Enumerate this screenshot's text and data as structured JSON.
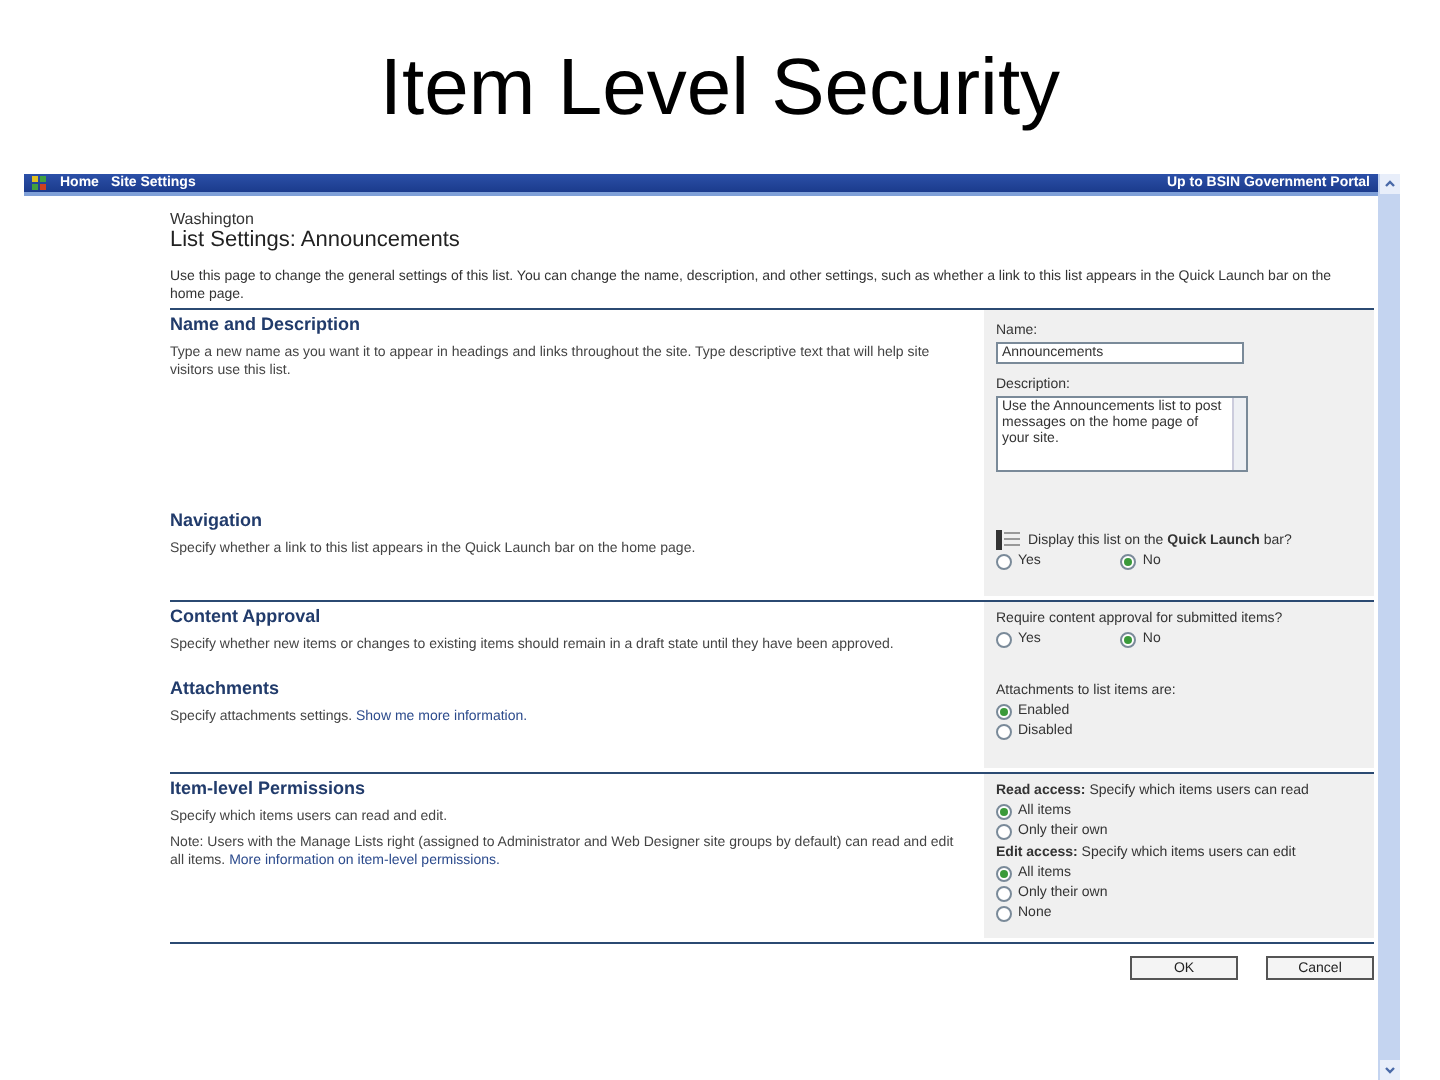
{
  "slide_title": "Item Level Security",
  "nav": {
    "links": [
      "Home",
      "Site Settings"
    ],
    "portal_link": "Up to BSIN Government Portal"
  },
  "site_name": "Washington",
  "page_title": "List Settings: Announcements",
  "intro": "Use this page to change the general settings of this list. You can change the name, description, and other settings, such as whether a link to this list appears in the Quick Launch bar on the home page.",
  "sections": [
    {
      "heading": "Name and Description",
      "divider_above": true,
      "descriptions": [
        {
          "text": "Type a new name as you want it to appear in headings and links throughout the site. Type descriptive text that will help site visitors use this list."
        }
      ],
      "fields": [
        {
          "kind": "text",
          "label": "Name:",
          "value": "Announcements"
        },
        {
          "kind": "textarea",
          "label": "Description:",
          "value": "Use the Announcements list to post messages on the home page of your site."
        }
      ]
    },
    {
      "heading": "Navigation",
      "divider_above": false,
      "descriptions": [
        {
          "text": "Specify whether a link to this list appears in the Quick Launch bar on the home page."
        }
      ],
      "fields": [
        {
          "kind": "radio-row",
          "label": "Display this list on the **Quick Launch** bar?",
          "options": [
            {
              "label": "Yes",
              "selected": false
            },
            {
              "label": "No",
              "selected": true
            }
          ]
        }
      ]
    },
    {
      "heading": "Content Approval",
      "divider_above": true,
      "descriptions": [
        {
          "text": "Specify whether new items or changes to existing items should remain in a draft state until they have been approved."
        }
      ],
      "fields": [
        {
          "kind": "radio-row",
          "label": "Require content approval for submitted items?",
          "options": [
            {
              "label": "Yes",
              "selected": false
            },
            {
              "label": "No",
              "selected": true
            }
          ]
        }
      ]
    },
    {
      "heading": "Attachments",
      "divider_above": false,
      "descriptions": [
        {
          "text": "Specify attachments settings.",
          "link": "Show me more information."
        }
      ],
      "fields": [
        {
          "kind": "radio-column",
          "label": "Attachments to list items are:",
          "options": [
            {
              "label": "Enabled",
              "selected": true
            },
            {
              "label": "Disabled",
              "selected": false
            }
          ]
        }
      ]
    },
    {
      "heading": "Item-level Permissions",
      "divider_above": true,
      "descriptions": [
        {
          "text": "Specify which items users can read and edit."
        },
        {
          "text": "Note: Users with the Manage Lists right (assigned to Administrator and Web Designer site groups by default) can read and edit all items.",
          "link": "More information on item-level permissions."
        }
      ],
      "fields": [
        {
          "kind": "radio-column",
          "label": "**Read access:** Specify which items users can read",
          "options": [
            {
              "label": "All items",
              "selected": true
            },
            {
              "label": "Only their own",
              "selected": false
            }
          ]
        },
        {
          "kind": "radio-column",
          "label": "**Edit access:** Specify which items users can edit",
          "options": [
            {
              "label": "All items",
              "selected": true
            },
            {
              "label": "Only their own",
              "selected": false
            },
            {
              "label": "None",
              "selected": false
            }
          ]
        }
      ]
    }
  ],
  "buttons": [
    "OK",
    "Cancel"
  ]
}
